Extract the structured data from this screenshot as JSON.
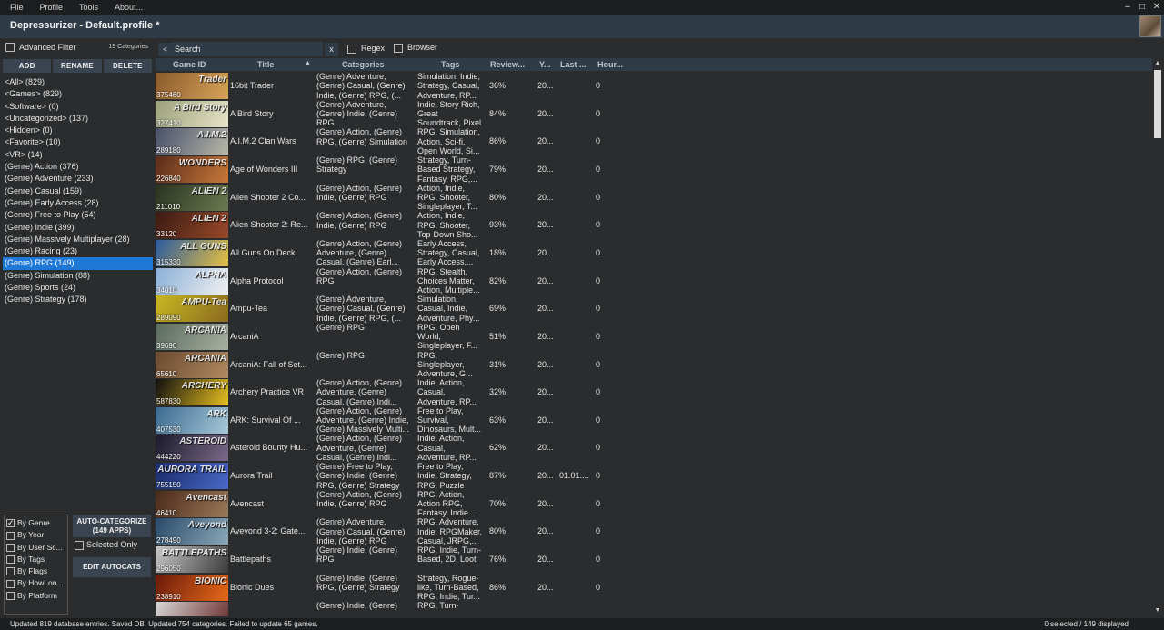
{
  "menu": [
    "File",
    "Profile",
    "Tools",
    "About..."
  ],
  "window": {
    "title": "Depressurizer - Default.profile *"
  },
  "left": {
    "advanced_filter": "Advanced Filter",
    "category_count": "19 Categories",
    "buttons": {
      "add": "ADD",
      "rename": "RENAME",
      "delete": "DELETE"
    },
    "categories": [
      "<All> (829)",
      "<Games> (829)",
      "<Software> (0)",
      "<Uncategorized> (137)",
      "<Hidden> (0)",
      "<Favorite> (10)",
      "<VR> (14)",
      "(Genre) Action (376)",
      "(Genre) Adventure (233)",
      "(Genre) Casual (159)",
      "(Genre) Early Access (28)",
      "(Genre) Free to Play (54)",
      "(Genre) Indie (399)",
      "(Genre) Massively Multiplayer (28)",
      "(Genre) Racing (23)",
      "(Genre) RPG (149)",
      "(Genre) Simulation (88)",
      "(Genre) Sports (24)",
      "(Genre) Strategy (178)"
    ],
    "selected_category_index": 15,
    "autocat_types": [
      {
        "label": "By Genre",
        "checked": true
      },
      {
        "label": "By Year",
        "checked": false
      },
      {
        "label": "By User Sc...",
        "checked": false
      },
      {
        "label": "By Tags",
        "checked": false
      },
      {
        "label": "By Flags",
        "checked": false
      },
      {
        "label": "By HowLon...",
        "checked": false
      },
      {
        "label": "By Platform",
        "checked": false
      }
    ],
    "auto_categorize_line1": "AUTO-CATEGORIZE",
    "auto_categorize_line2": "(149 APPS)",
    "selected_only": "Selected Only",
    "edit_autocats": "EDIT AUTOCATS"
  },
  "search": {
    "placeholder": "Search",
    "arrow": "<",
    "clear": "x",
    "regex": "Regex",
    "browser": "Browser"
  },
  "table": {
    "headers": {
      "game_id": "Game ID",
      "title": "Title",
      "categories": "Categories",
      "tags": "Tags",
      "reviews": "Review...",
      "year": "Y...",
      "last": "Last ...",
      "hours": "Hour..."
    },
    "rows": [
      {
        "id": "375460",
        "thumb": "Trader",
        "thumb_colors": [
          "#8a5a2c",
          "#d8a458"
        ],
        "title": "16bit Trader",
        "categories": "(Genre) Adventure, (Genre) Casual, (Genre) Indie, (Genre) RPG, (...",
        "tags": "Simulation, Indie, Strategy, Casual, Adventure, RP...",
        "reviews": "36%",
        "year": "20...",
        "last": "",
        "hours": "0"
      },
      {
        "id": "327410",
        "thumb": "A Bird Story",
        "thumb_colors": [
          "#9aa07a",
          "#e8e4c8"
        ],
        "title": "A Bird Story",
        "categories": "(Genre) Adventure, (Genre) Indie, (Genre) RPG",
        "tags": "Indie, Story Rich, Great Soundtrack, Pixel Graphics,...",
        "reviews": "84%",
        "year": "20...",
        "last": "",
        "hours": "0"
      },
      {
        "id": "289180",
        "thumb": "A.I.M.2",
        "thumb_colors": [
          "#48506a",
          "#b8b8a8"
        ],
        "title": "A.I.M.2 Clan Wars",
        "categories": "(Genre) Action, (Genre) RPG, (Genre) Simulation",
        "tags": "RPG, Simulation, Action, Sci-fi, Open World, Si...",
        "reviews": "86%",
        "year": "20...",
        "last": "",
        "hours": "0"
      },
      {
        "id": "226840",
        "thumb": "WONDERS",
        "thumb_colors": [
          "#5a2c1a",
          "#c8783a"
        ],
        "title": "Age of Wonders III",
        "categories": "(Genre) RPG, (Genre) Strategy",
        "tags": "Strategy, Turn-Based Strategy, Fantasy, RPG,...",
        "reviews": "79%",
        "year": "20...",
        "last": "",
        "hours": "0"
      },
      {
        "id": "211010",
        "thumb": "ALIEN 2",
        "thumb_colors": [
          "#2a3220",
          "#6a7a50"
        ],
        "title": "Alien Shooter 2 Co...",
        "categories": "(Genre) Action, (Genre) Indie, (Genre) RPG",
        "tags": "Action, Indie, RPG, Shooter, Singleplayer, T...",
        "reviews": "80%",
        "year": "20...",
        "last": "",
        "hours": "0"
      },
      {
        "id": "33120",
        "thumb": "ALIEN 2",
        "thumb_colors": [
          "#3a1a12",
          "#9a4a2a"
        ],
        "title": "Alien Shooter 2: Re...",
        "categories": "(Genre) Action, (Genre) Indie, (Genre) RPG",
        "tags": "Action, Indie, RPG, Shooter, Top-Down Sho...",
        "reviews": "93%",
        "year": "20...",
        "last": "",
        "hours": "0"
      },
      {
        "id": "315330",
        "thumb": "ALL GUNS",
        "thumb_colors": [
          "#2a5aa0",
          "#e8c040"
        ],
        "title": "All Guns On Deck",
        "categories": "(Genre) Action, (Genre) Adventure, (Genre) Casual, (Genre) Earl...",
        "tags": "Early Access, Strategy, Casual, Early Access,...",
        "reviews": "18%",
        "year": "20...",
        "last": "",
        "hours": "0"
      },
      {
        "id": "34010",
        "thumb": "ALPHA",
        "thumb_colors": [
          "#8ab0d8",
          "#f0f0f0"
        ],
        "title": "Alpha Protocol",
        "categories": "(Genre) Action, (Genre) RPG",
        "tags": "RPG, Stealth, Choices Matter, Action, Multiple...",
        "reviews": "82%",
        "year": "20...",
        "last": "",
        "hours": "0"
      },
      {
        "id": "289090",
        "thumb": "AMPU-Tea",
        "thumb_colors": [
          "#c8b820",
          "#8a6a20"
        ],
        "title": "Ampu-Tea",
        "categories": "(Genre) Adventure, (Genre) Casual, (Genre) Indie, (Genre) RPG, (...",
        "tags": "Simulation, Casual, Indie, Adventure, Phy...",
        "reviews": "69%",
        "year": "20...",
        "last": "",
        "hours": "0"
      },
      {
        "id": "39690",
        "thumb": "ARCANIA",
        "thumb_colors": [
          "#5a6a60",
          "#a8b0a0"
        ],
        "title": "ArcaniA",
        "categories": "(Genre) RPG",
        "tags": "RPG, Open World, Singleplayer, F...",
        "reviews": "51%",
        "year": "20...",
        "last": "",
        "hours": "0"
      },
      {
        "id": "65610",
        "thumb": "ARCANIA",
        "thumb_colors": [
          "#6a4a30",
          "#b08a60"
        ],
        "title": "ArcaniA: Fall of Set...",
        "categories": "(Genre) RPG",
        "tags": "RPG, Singleplayer, Adventure, G...",
        "reviews": "31%",
        "year": "20...",
        "last": "",
        "hours": "0"
      },
      {
        "id": "587830",
        "thumb": "ARCHERY",
        "thumb_colors": [
          "#101010",
          "#e8c020"
        ],
        "title": "Archery Practice VR",
        "categories": "(Genre) Action, (Genre) Adventure, (Genre) Casual, (Genre) Indi...",
        "tags": "Indie, Action, Casual, Adventure, RP...",
        "reviews": "32%",
        "year": "20...",
        "last": "",
        "hours": "0"
      },
      {
        "id": "407530",
        "thumb": "ARK",
        "thumb_colors": [
          "#3a6a90",
          "#a8c8d8"
        ],
        "title": "ARK: Survival Of ...",
        "categories": "(Genre) Action, (Genre) Adventure, (Genre) Indie, (Genre) Massively Multi...",
        "tags": "Free to Play, Survival, Dinosaurs, Mult...",
        "reviews": "63%",
        "year": "20...",
        "last": "",
        "hours": "0"
      },
      {
        "id": "444220",
        "thumb": "ASTEROID",
        "thumb_colors": [
          "#1a1a2a",
          "#7a6a8a"
        ],
        "title": "Asteroid Bounty Hu...",
        "categories": "(Genre) Action, (Genre) Adventure, (Genre) Casual, (Genre) Indi...",
        "tags": "Indie, Action, Casual, Adventure, RP...",
        "reviews": "62%",
        "year": "20...",
        "last": "",
        "hours": "0"
      },
      {
        "id": "755150",
        "thumb": "AURORA TRAIL",
        "thumb_colors": [
          "#1a2a6a",
          "#4a6ac8"
        ],
        "title": "Aurora Trail",
        "categories": "(Genre) Free to Play, (Genre) Indie, (Genre) RPG, (Genre) Strategy",
        "tags": "Free to Play, Indie, Strategy, RPG, Puzzle",
        "reviews": "87%",
        "year": "20...",
        "last": "01.01....",
        "hours": "0"
      },
      {
        "id": "46410",
        "thumb": "Avencast",
        "thumb_colors": [
          "#4a2a1a",
          "#9a7a5a"
        ],
        "title": "Avencast",
        "categories": "(Genre) Action, (Genre) Indie, (Genre) RPG",
        "tags": "RPG, Action, Action RPG, Fantasy, Indie...",
        "reviews": "70%",
        "year": "20...",
        "last": "",
        "hours": "0"
      },
      {
        "id": "278490",
        "thumb": "Aveyond",
        "thumb_colors": [
          "#2a4a6a",
          "#8aa8b8"
        ],
        "title": "Aveyond 3-2: Gate...",
        "categories": "(Genre) Adventure, (Genre) Casual, (Genre) Indie, (Genre) RPG",
        "tags": "RPG, Adventure, Indie, RPGMaker, Casual, JRPG,...",
        "reviews": "80%",
        "year": "20...",
        "last": "",
        "hours": "0"
      },
      {
        "id": "296050",
        "thumb": "BATTLEPATHS",
        "thumb_colors": [
          "#c8c8c8",
          "#3a3a3a"
        ],
        "title": "Battlepaths",
        "categories": "(Genre) Indie, (Genre) RPG",
        "tags": "RPG, Indie, Turn-Based, 2D, Loot",
        "reviews": "76%",
        "year": "20...",
        "last": "",
        "hours": "0"
      },
      {
        "id": "238910",
        "thumb": "BIONIC",
        "thumb_colors": [
          "#6a1a0a",
          "#e86a1a"
        ],
        "title": "Bionic Dues",
        "categories": "(Genre) Indie, (Genre) RPG, (Genre) Strategy",
        "tags": "Strategy, Rogue-like, Turn-Based, RPG, Indie, Tur...",
        "reviews": "86%",
        "year": "20...",
        "last": "",
        "hours": "0"
      },
      {
        "id": "",
        "thumb": "",
        "thumb_colors": [
          "#d8d8d8",
          "#6a2a2a"
        ],
        "title": "",
        "categories": "(Genre) Indie, (Genre)",
        "tags": "RPG, Turn-",
        "reviews": "",
        "year": "",
        "last": "",
        "hours": ""
      }
    ]
  },
  "status": {
    "left": "Updated 819 database entries. Saved DB. Updated 754 categories. Failed to update 65 games.",
    "right": "0 selected / 149 displayed"
  },
  "colors": {
    "accent": "#1e78d6",
    "header": "#2f3b46",
    "background": "#2a2c2e"
  }
}
